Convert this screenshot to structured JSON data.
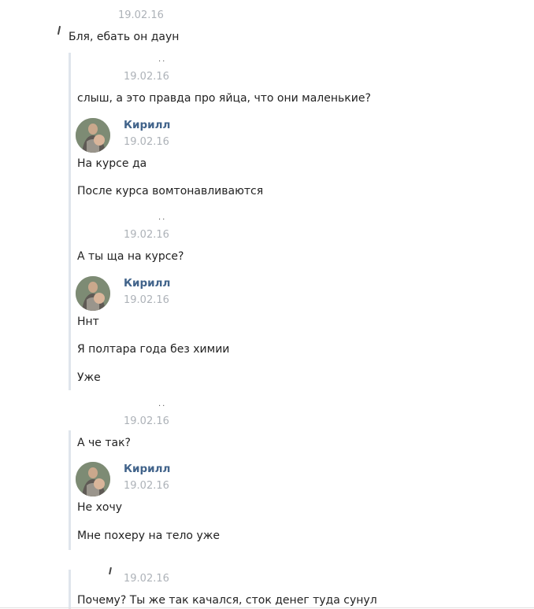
{
  "thread": {
    "top": {
      "date": "19.02.16",
      "text": "Бля, ебать он даун"
    },
    "q1": {
      "date": "19.02.16",
      "text": "слыш, а это правда про яйца, что они маленькие?"
    },
    "r1": {
      "author": "Кирилл",
      "date": "19.02.16",
      "lines": [
        "На курсе да",
        "После курса вомтонавливаются"
      ]
    },
    "q2": {
      "date": "19.02.16",
      "text": "А ты ща на курсе?"
    },
    "r2": {
      "author": "Кирилл",
      "date": "19.02.16",
      "lines": [
        "Ннт",
        "Я полтара года без химии",
        "Уже"
      ]
    },
    "q3": {
      "date": "19.02.16",
      "text": "А че так?"
    },
    "r3": {
      "author": "Кирилл",
      "date": "19.02.16",
      "lines": [
        "Не хочу",
        "Мне похеру на тело уже"
      ]
    },
    "q4": {
      "date": "19.02.16",
      "text": "Почему? Ты же так качался, сток денег туда сунул"
    }
  }
}
